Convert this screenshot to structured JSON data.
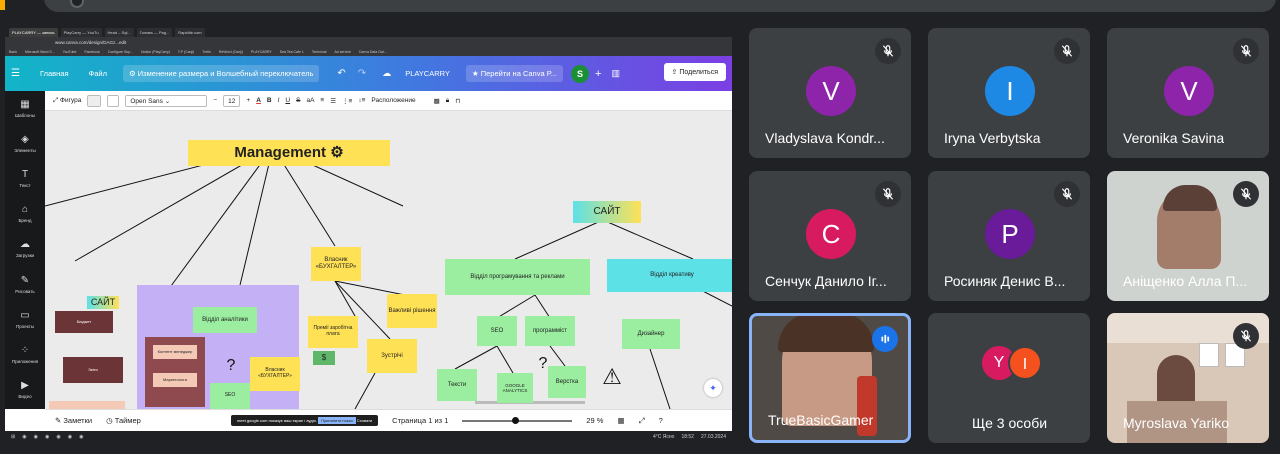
{
  "meet": {
    "participants": [
      {
        "name": "Vladyslava Kondr...",
        "initial": "V",
        "color": "#8e24aa",
        "muted": true
      },
      {
        "name": "Iryna Verbytska",
        "initial": "I",
        "color": "#1e88e5",
        "muted": true
      },
      {
        "name": "Veronika Savina",
        "initial": "V",
        "color": "#8e24aa",
        "muted": true
      },
      {
        "name": "Сенчук Данило Іг...",
        "initial": "C",
        "color": "#d81b60",
        "muted": true
      },
      {
        "name": "Росиняк Денис В...",
        "initial": "P",
        "color": "#6a1b9a",
        "muted": true
      },
      {
        "name": "Аніщенко Алла П...",
        "initial": "",
        "color": "#cfd3cf",
        "muted": true
      },
      {
        "name": "TrueBasicGamer",
        "initial": "",
        "color": "#4f4a45",
        "muted": false
      },
      {
        "name": "Ще 3 особи",
        "initial": "",
        "color": "#3c4043",
        "muted": false
      },
      {
        "name": "Myroslava Yariko",
        "initial": "",
        "color": "#d9c8b8",
        "muted": true
      }
    ],
    "more_avatars": [
      {
        "initial": "Y",
        "color": "#d81b60"
      },
      {
        "initial": "I",
        "color": "#f4511e"
      }
    ],
    "speaking_icon": "audio-bars-icon",
    "muted_icon": "mic-off-icon"
  },
  "browser": {
    "tabs": [
      "PLAYCARRY — запись",
      "PlayCarry — YouTu",
      "Head – Sql...",
      "Голова — Pag...",
      "Rapidité.com"
    ],
    "url": "www.canva.com/design/DAGz...edit",
    "bookmarks": [
      "Bank",
      "Microsoft Word S...",
      "YouTube",
      "Facebook",
      "Configure Sup...",
      "Notion (PlayCarry)",
      "T.P (Canji)",
      "Trello",
      "ReWord (Canji)",
      "PLAYCARRY",
      "Sea Tea Cafe 1",
      "Technical",
      "Ad service",
      "Canva Data Gal..."
    ]
  },
  "canva": {
    "home": "Главная",
    "file": "Файл",
    "resize": "Изменение размера и Волшебный переключатель",
    "title": "PLAYCARRY",
    "pro": "Перейти на Canva P...",
    "avatar": "S",
    "share": "Поделиться",
    "sidebar": [
      "Шаблоны",
      "Элементы",
      "Текст",
      "Бренд",
      "Загрузки",
      "Рисовать",
      "Проекты",
      "Приложения",
      "Видео"
    ],
    "toolbar": {
      "shape": "Фигура",
      "font": "Open Sans",
      "size": "12",
      "position": "Расположение"
    },
    "bottom": {
      "notes": "Заметки",
      "timer": "Таймер",
      "page": "Страница 1 из 1",
      "zoom": "29 %"
    },
    "share_notice": "meet.google.com показує ваш екран і аудіо.",
    "stop_share": "Припинити показ",
    "hide": "Сховати"
  },
  "diagram": {
    "management": "Management",
    "site": "САЙТ",
    "site2": "САЙТ",
    "owner": "Власник «БУХГАЛТЕР»",
    "dev_ads": "Відділ програмування та реклами",
    "creative": "Відділ креативу",
    "analytics": "Відділ аналітики",
    "earn": "Премії заробітна плата",
    "decisions": "Важливі рішення",
    "meetings": "Зустрічі",
    "seo": "SEO",
    "programmer": "программіст",
    "designer": "Дизайнер",
    "texts": "Тексти",
    "google": "GOOGLE ANALYTICS",
    "layout": "Верстка",
    "owner2": "Власник «БУХГАЛТЕР»",
    "seo2": "SEO",
    "content": "Контент менеджер",
    "marketer": "Маркетологи",
    "budget": "Бюджет",
    "reports": "Звіти"
  },
  "taskbar": {
    "weather": "4°C Ясно",
    "time": "18:52",
    "date": "27.03.2024"
  }
}
